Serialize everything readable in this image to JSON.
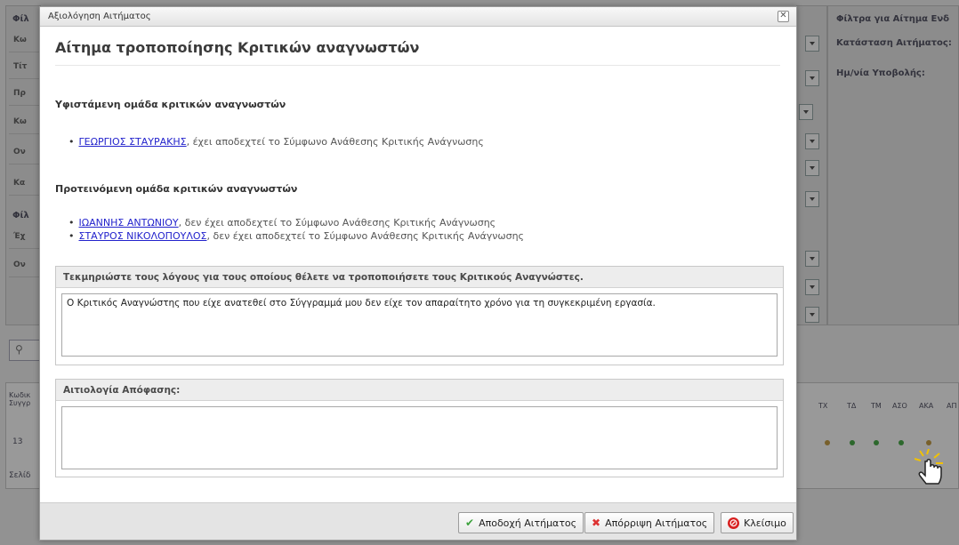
{
  "background": {
    "right_panel_title": "Φίλτρα για Αίτημα Ενδ",
    "right_labels": [
      "Κατάσταση Αιτήματος:",
      "Ημ/νία Υποβολής:"
    ],
    "left_header": "Φίλ",
    "left_rows": [
      "Κω",
      "Τίτ",
      "Πρ",
      "Κω",
      "Ον",
      "Κα"
    ],
    "left_header2": "Φίλ",
    "left_rows2": [
      "Έχ",
      "Ον"
    ],
    "grid_cols_left": "Κωδικ Συγγρ",
    "grid_cols_right": [
      "ΤΧ",
      "ΤΔ",
      "ΤΜ",
      "ΑΣΟ",
      "ΑΚΑ",
      "ΑΠ"
    ],
    "grid_row_id": "13",
    "pager_label": "Σελίδ",
    "dot_colors": [
      "#c9a04a",
      "#4cae4c",
      "#4cae4c",
      "#4cae4c",
      "#c9a04a"
    ]
  },
  "dialog": {
    "window_title": "Αξιολόγηση Αιτήματος",
    "heading": "Αίτημα τροποποίησης Κριτικών αναγνωστών",
    "existing_title": "Υφιστάμενη ομάδα κριτικών αναγνωστών",
    "existing": [
      {
        "name": "ΓΕΩΡΓΙΟΣ ΣΤΑΥΡΑΚΗΣ",
        "status": ", έχει αποδεχτεί το Σύμφωνο Ανάθεσης Κριτικής Ανάγνωσης"
      }
    ],
    "proposed_title": "Προτεινόμενη ομάδα κριτικών αναγνωστών",
    "proposed": [
      {
        "name": "ΙΩΑΝΝΗΣ ΑΝΤΩΝΙΟΥ",
        "status": ", δεν έχει αποδεχτεί το Σύμφωνο Ανάθεσης Κριτικής Ανάγνωσης"
      },
      {
        "name": "ΣΤΑΥΡΟΣ ΝΙΚΟΛΟΠΟΥΛΟΣ",
        "status": ", δεν έχει αποδεχτεί το Σύμφωνο Ανάθεσης Κριτικής Ανάγνωσης"
      }
    ],
    "reason_label": "Τεκμηριώστε τους λόγους για τους οποίους θέλετε να τροποποιήσετε τους Κριτικούς Αναγνώστες.",
    "reason_text": "Ο Κριτικός Αναγνώστης που είχε ανατεθεί στο Σύγγραμμά μου δεν είχε τον απαραίτητο χρόνο για τη συγκεκριμένη εργασία.",
    "decision_label": "Αιτιολογία Απόφασης:",
    "decision_text": "",
    "accept_label": "Αποδοχή Αιτήματος",
    "reject_label": "Απόρριψη Αιτήματος",
    "close_label": "Κλείσιμο"
  }
}
